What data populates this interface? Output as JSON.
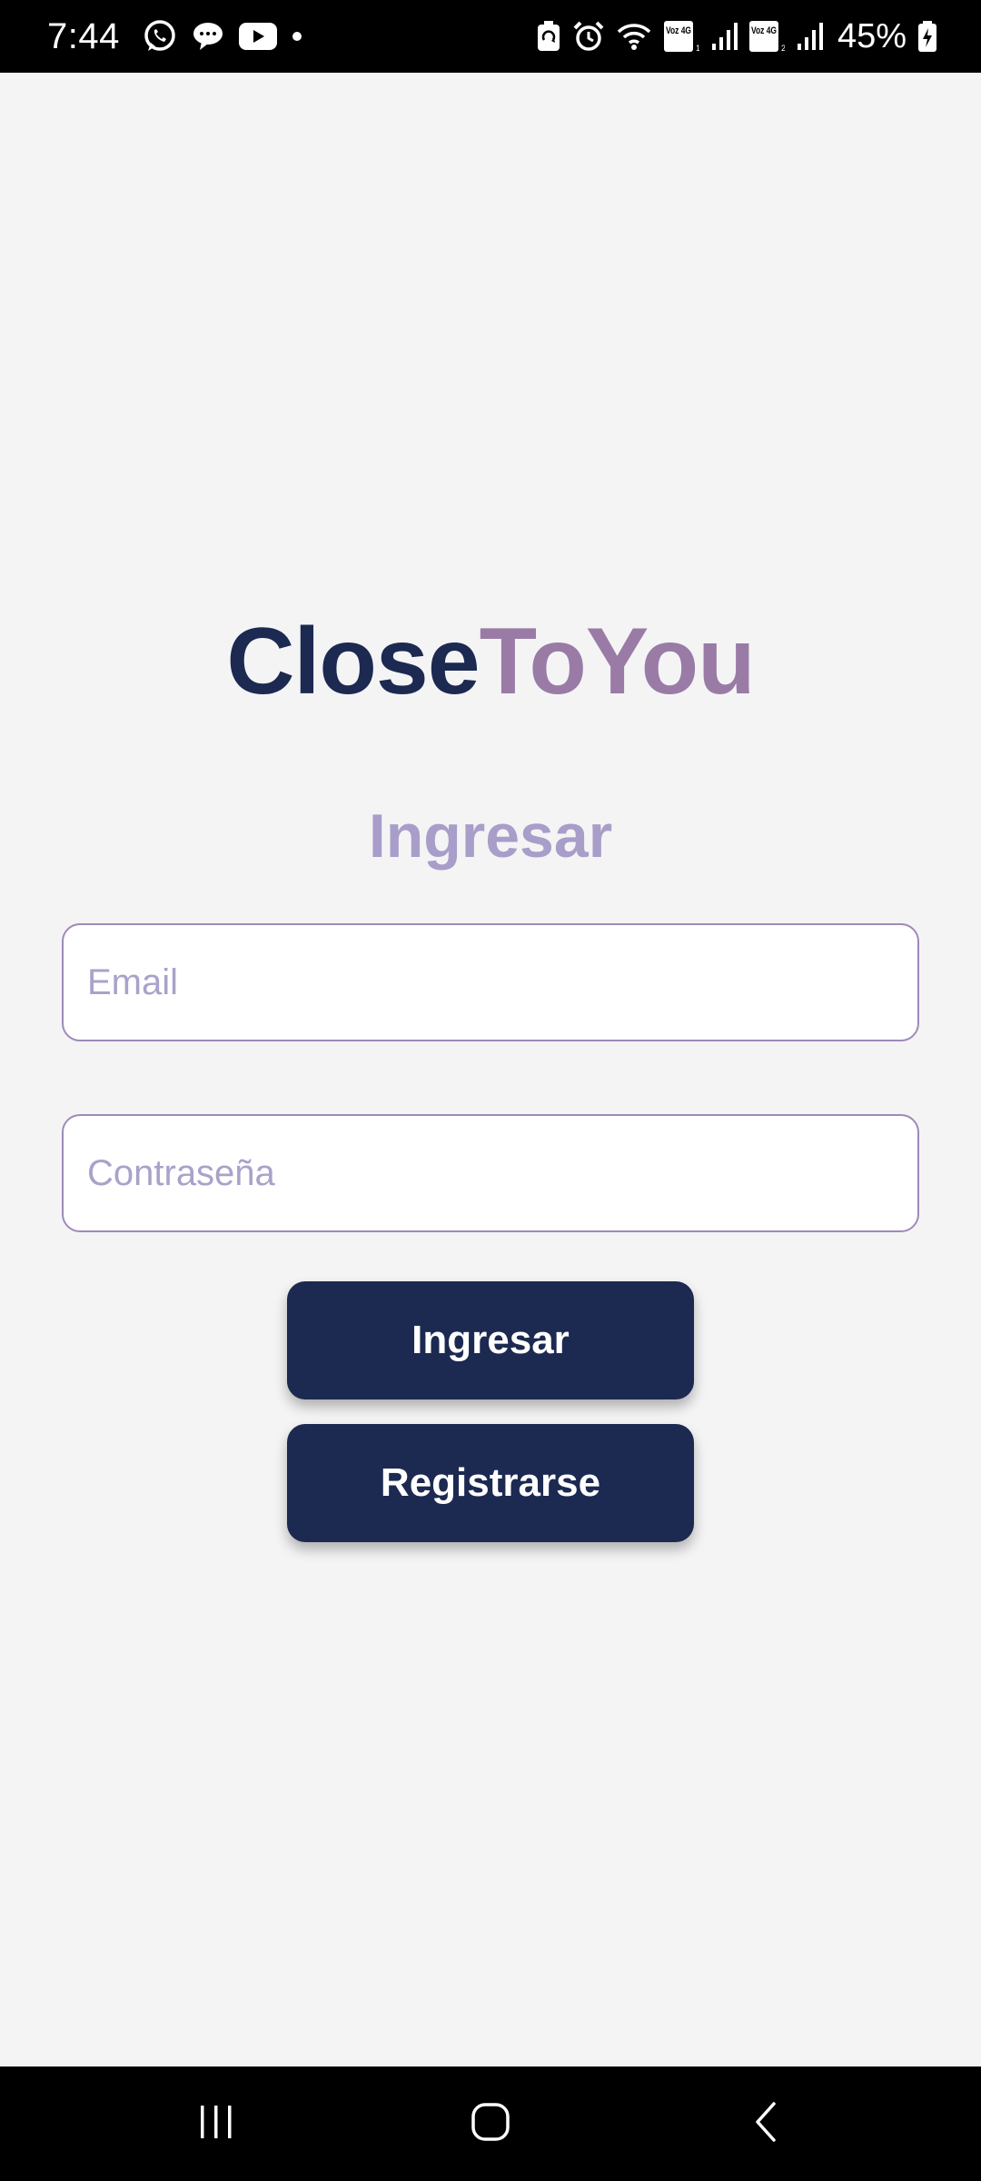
{
  "status_bar": {
    "time": "7:44",
    "battery": "45%",
    "left_icons": [
      "whatsapp-icon",
      "chat-bubble-icon",
      "youtube-icon",
      "dot-icon"
    ],
    "right_icons": [
      "battery-saver-icon",
      "alarm-icon",
      "wifi-icon",
      "volte-4g-sim1-icon",
      "signal-sim1-icon",
      "volte-4g-sim2-icon",
      "signal-sim2-icon",
      "battery-icon"
    ],
    "sim1_label": "Voz 4G",
    "sim2_label": "Voz 4G"
  },
  "app": {
    "title_part1": "Close",
    "title_part2": "ToYou",
    "section_title": "Ingresar"
  },
  "form": {
    "email_placeholder": "Email",
    "email_value": "",
    "password_placeholder": "Contraseña",
    "password_value": ""
  },
  "buttons": {
    "login_label": "Ingresar",
    "register_label": "Registrarse"
  },
  "nav_bar": {
    "icons": [
      "recent-apps-icon",
      "home-icon",
      "back-icon"
    ]
  },
  "colors": {
    "primary": "#1c2951",
    "accent": "#9a7ba6",
    "section_title": "#a89ec9",
    "background": "#f4f4f5",
    "input_border": "#a08ab8"
  }
}
